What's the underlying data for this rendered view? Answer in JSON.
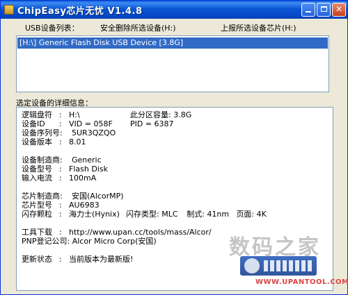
{
  "window": {
    "title": "ChipEasy芯片无忧 V1.4.8"
  },
  "menu": {
    "items": [
      "USB设备列表：",
      "安全删除所选设备(H:)",
      "上报所选设备芯片(H:)"
    ]
  },
  "device_list": {
    "selected": "[H:\\] Generic Flash Disk USB Device [3.8G]"
  },
  "details": {
    "label": "选定设备的详细信息：",
    "drive_letter_label": "逻辑盘符",
    "drive_letter_value": "H:\\",
    "partition_label": "此分区容量:",
    "partition_value": "3.8G",
    "device_id_label": "设备ID",
    "vid_value": "VID = 058F",
    "pid_value": "PID = 6387",
    "serial_label": "设备序列号:",
    "serial_value": "5UR3QZQO",
    "version_label": "设备版本",
    "version_value": "8.01",
    "vendor_label": "设备制造商:",
    "vendor_value": "Generic",
    "model_label": "设备型号",
    "model_value": "Flash Disk",
    "current_label": "输入电流",
    "current_value": "100mA",
    "chip_vendor_label": "芯片制造商:",
    "chip_vendor_value": "安国(AlcorMP)",
    "chip_model_label": "芯片型号",
    "chip_model_value": "AU6983",
    "flash_label": "闪存颗粒",
    "flash_value": "海力士(Hynix)",
    "flash_type_label": "闪存类型:",
    "flash_type_value": "MLC",
    "process_label": "制式:",
    "process_value": "41nm",
    "page_label": "页面:",
    "page_value": "4K",
    "tool_label": "工具下载",
    "tool_value": "http://www.upan.cc/tools/mass/Alcor/",
    "pnp_label": "PNP登记公司:",
    "pnp_value": "Alcor Micro Corp(安国)",
    "update_label": "更新状态",
    "update_value": "当前版本为最新版!"
  },
  "watermark": {
    "text": "数码之家",
    "url": "WWW.UPANTOOL.COM"
  }
}
